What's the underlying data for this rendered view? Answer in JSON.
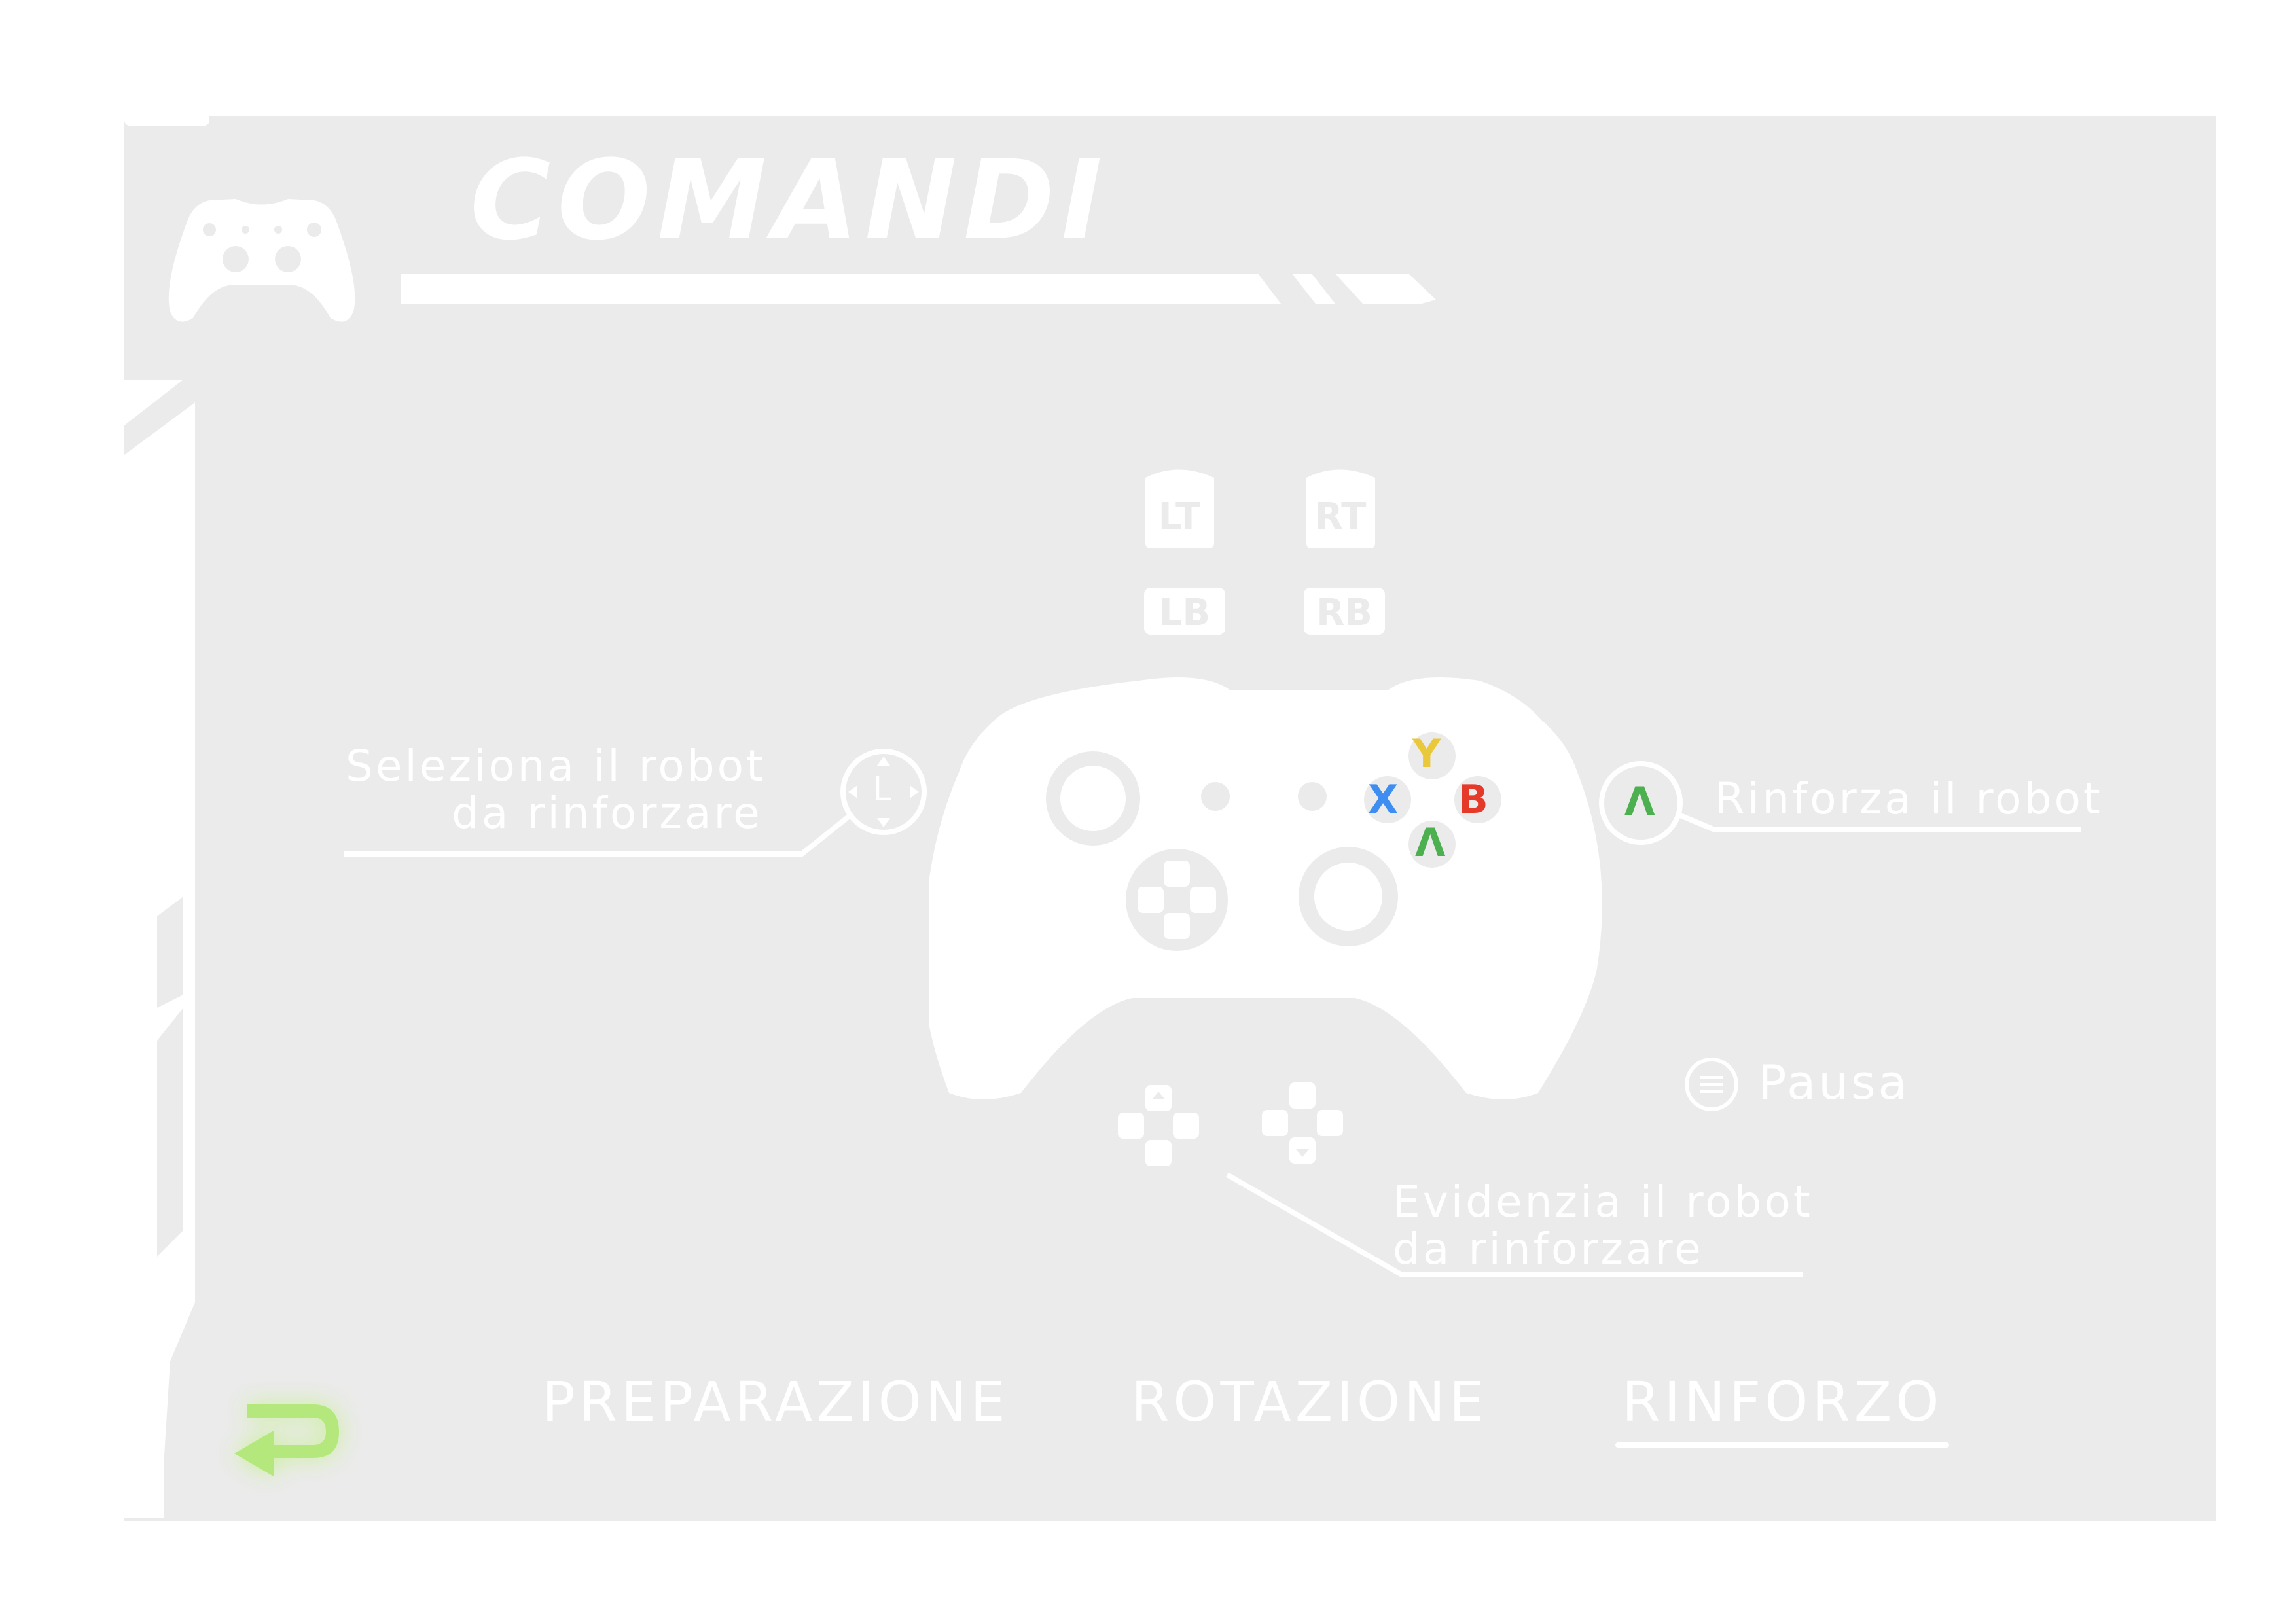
{
  "header": {
    "title": "COMANDI",
    "icon": "gamepad-icon"
  },
  "shoulder_buttons": {
    "lt": "LT",
    "rt": "RT",
    "lb": "LB",
    "rb": "RB"
  },
  "face_buttons": {
    "y": "Y",
    "x": "X",
    "b": "B",
    "a": "Λ",
    "stick": "L"
  },
  "colors": {
    "y": "#e9c93b",
    "x": "#3d8ef0",
    "b": "#e53a2a",
    "a": "#4caf50",
    "back": "#b4e87c",
    "panel": "#ebebeb"
  },
  "callouts": {
    "select_line1": "Seleziona il robot",
    "select_line2": "da rinforzare",
    "reinforce": "Rinforza il robot",
    "pause": "Pausa",
    "highlight_line1": "Evidenzia il robot",
    "highlight_line2": "da rinforzare"
  },
  "tabs": [
    {
      "label": "PREPARAZIONE",
      "active": false
    },
    {
      "label": "ROTAZIONE",
      "active": false
    },
    {
      "label": "RINFORZO",
      "active": true
    }
  ],
  "back_button": {
    "icon": "return-arrow-icon"
  }
}
